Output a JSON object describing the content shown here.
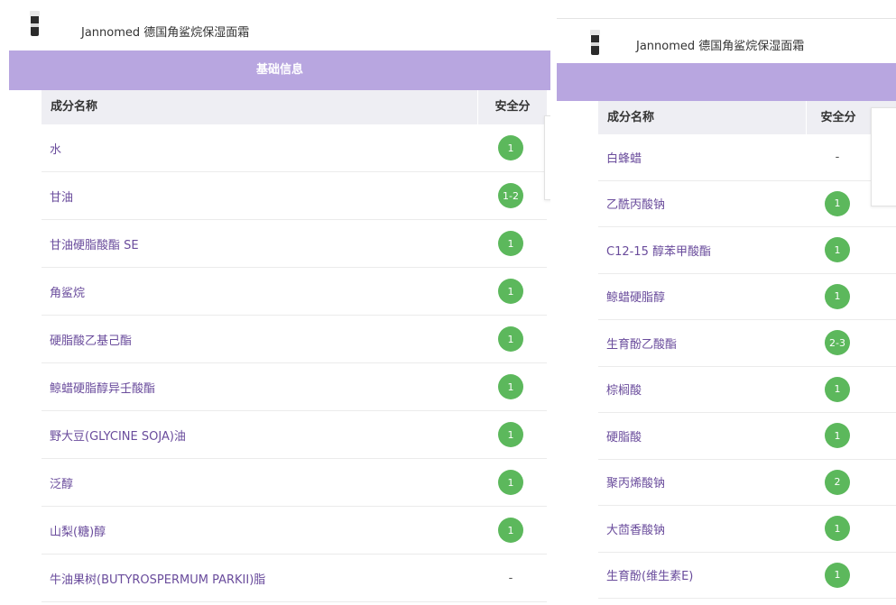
{
  "left_panel": {
    "product_title": "Jannomed 德国角鲨烷保湿面霜",
    "section_title": "基础信息",
    "columns": {
      "name": "成分名称",
      "score": "安全分"
    },
    "rows": [
      {
        "name": "水",
        "score": "1"
      },
      {
        "name": "甘油",
        "score": "1-2"
      },
      {
        "name": "甘油硬脂酸酯 SE",
        "score": "1"
      },
      {
        "name": "角鲨烷",
        "score": "1"
      },
      {
        "name": "硬脂酸乙基己酯",
        "score": "1"
      },
      {
        "name": "鲸蜡硬脂醇异壬酸酯",
        "score": "1"
      },
      {
        "name": "野大豆(GLYCINE SOJA)油",
        "score": "1"
      },
      {
        "name": "泛醇",
        "score": "1"
      },
      {
        "name": "山梨(糖)醇",
        "score": "1"
      },
      {
        "name": "牛油果树(BUTYROSPERMUM PARKII)脂",
        "score": "-"
      }
    ]
  },
  "right_panel": {
    "product_title": "Jannomed 德国角鲨烷保湿面霜",
    "section_title": "",
    "columns": {
      "name": "成分名称",
      "score": "安全分"
    },
    "rows": [
      {
        "name": "白蜂蜡",
        "score": "-"
      },
      {
        "name": "乙酰丙酸钠",
        "score": "1"
      },
      {
        "name": "C12-15 醇苯甲酸酯",
        "score": "1"
      },
      {
        "name": "鲸蜡硬脂醇",
        "score": "1"
      },
      {
        "name": "生育酚乙酸酯",
        "score": "2-3"
      },
      {
        "name": "棕榈酸",
        "score": "1"
      },
      {
        "name": "硬脂酸",
        "score": "1"
      },
      {
        "name": "聚丙烯酸钠",
        "score": "2"
      },
      {
        "name": "大茴香酸钠",
        "score": "1"
      },
      {
        "name": "生育酚(维生素E)",
        "score": "1"
      }
    ]
  },
  "colors": {
    "section_bar": "#b8a6e0",
    "badge_green": "#5cb85c",
    "ingredient_text": "#6a4c9c",
    "header_bg": "#eeeef3"
  },
  "icons": {
    "product_thumbnail": "cream-bottle-icon"
  }
}
